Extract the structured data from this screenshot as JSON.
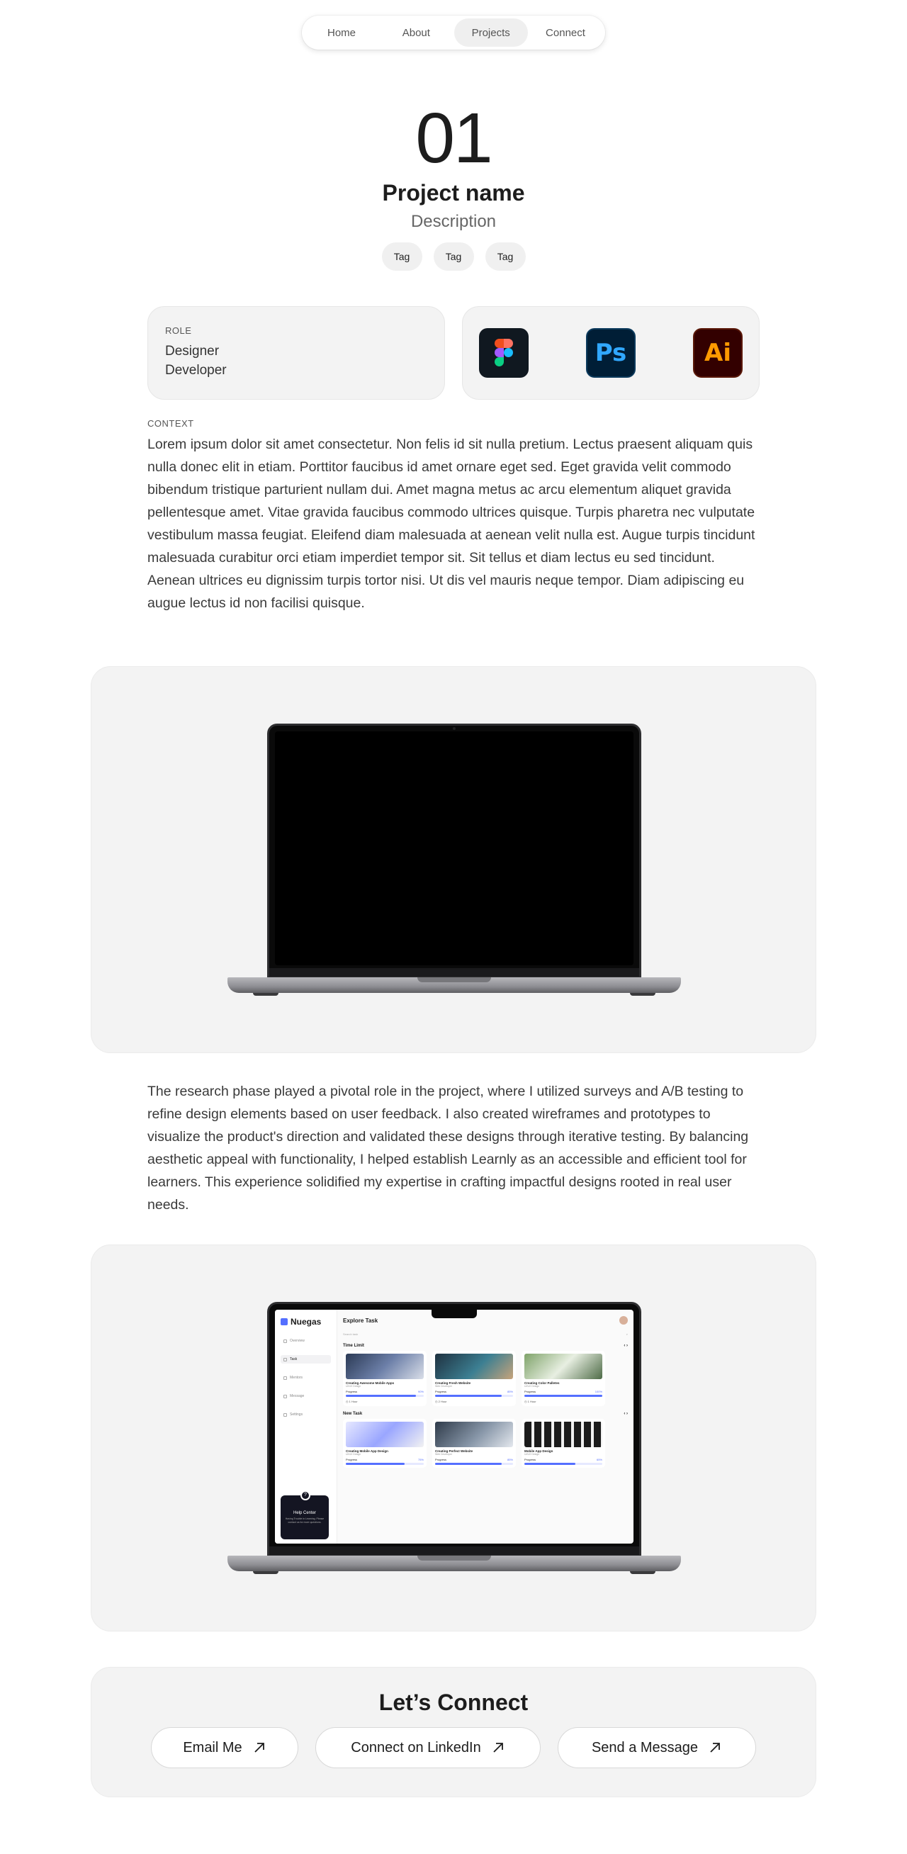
{
  "nav": {
    "items": [
      {
        "label": "Home",
        "active": false
      },
      {
        "label": "About",
        "active": false
      },
      {
        "label": "Projects",
        "active": true
      },
      {
        "label": "Connect",
        "active": false
      }
    ]
  },
  "hero": {
    "number": "01",
    "title": "Project name",
    "description": "Description",
    "tags": [
      "Tag",
      "Tag",
      "Tag"
    ]
  },
  "role": {
    "label": "ROLE",
    "lines": [
      "Designer",
      "Developer"
    ]
  },
  "tools": [
    {
      "name": "figma-icon",
      "text": ""
    },
    {
      "name": "photoshop-icon",
      "text": "Ps"
    },
    {
      "name": "illustrator-icon",
      "text": "Ai"
    }
  ],
  "context": {
    "label": "CONTEXT",
    "body": "Lorem ipsum dolor sit amet consectetur. Non felis id sit nulla pretium. Lectus praesent aliquam quis nulla donec elit in etiam. Porttitor faucibus id amet ornare eget sed. Eget gravida velit commodo bibendum tristique parturient nullam dui. Amet magna metus ac arcu elementum aliquet gravida pellentesque amet. Vitae gravida faucibus commodo ultrices quisque. Turpis pharetra nec vulputate vestibulum massa feugiat. Eleifend diam malesuada at aenean velit nulla est. Augue turpis tincidunt malesuada curabitur orci etiam imperdiet tempor sit. Sit tellus et diam lectus eu sed tincidunt. Aenean ultrices eu dignissim turpis tortor nisi. Ut dis vel mauris neque tempor. Diam adipiscing eu augue lectus id non facilisi quisque."
  },
  "research": {
    "body": "The research phase played a pivotal role in the project, where I utilized surveys and A/B testing to refine design elements based on user feedback. I also created wireframes and prototypes to visualize the product's direction and validated these designs through iterative testing. By balancing aesthetic appeal with functionality, I helped establish Learnly as an accessible and efficient tool for learners. This experience solidified my expertise in crafting impactful designs rooted in real user needs."
  },
  "app": {
    "logo": "Nuegas",
    "page_title": "Explore Task",
    "search_placeholder": "Search task",
    "sidebar": [
      "Overview",
      "Task",
      "Mentors",
      "Message",
      "Settings"
    ],
    "help_title": "Help Center",
    "help_sub": "Having Trouble in Learning. Please contact us for more questions.",
    "section_time": "Time Limit",
    "section_new": "New Task",
    "time_tasks": [
      {
        "name": "Creating Awesome Mobile Apps",
        "sub": "UI/UX Design",
        "progress_label": "Progress",
        "progress": 0.9,
        "progress_text": "90%",
        "foot": "1 Hour"
      },
      {
        "name": "Creating Fresh Website",
        "sub": "Web Developer",
        "progress_label": "Progress",
        "progress": 0.85,
        "progress_text": "85%",
        "foot": "2 Hour"
      },
      {
        "name": "Creating Color Palletes",
        "sub": "UI/UX Design",
        "progress_label": "Progress",
        "progress": 1.0,
        "progress_text": "100%",
        "foot": "1 Hour"
      }
    ],
    "new_tasks": [
      {
        "name": "Creating Mobile App Design",
        "sub": "UI/UX Design",
        "progress_label": "Progress",
        "progress": 0.75,
        "progress_text": "75%"
      },
      {
        "name": "Creating Perfect Website",
        "sub": "Web Developer",
        "progress_label": "Progress",
        "progress": 0.85,
        "progress_text": "85%"
      },
      {
        "name": "Mobile App Design",
        "sub": "UI/UX Design",
        "progress_label": "Progress",
        "progress": 0.65,
        "progress_text": "65%"
      }
    ]
  },
  "connect": {
    "title": "Let’s Connect",
    "buttons": [
      "Email Me",
      "Connect on LinkedIn",
      "Send a Message"
    ]
  },
  "colors": {
    "accent": "#546fff",
    "card_bg": "#f3f3f3"
  }
}
